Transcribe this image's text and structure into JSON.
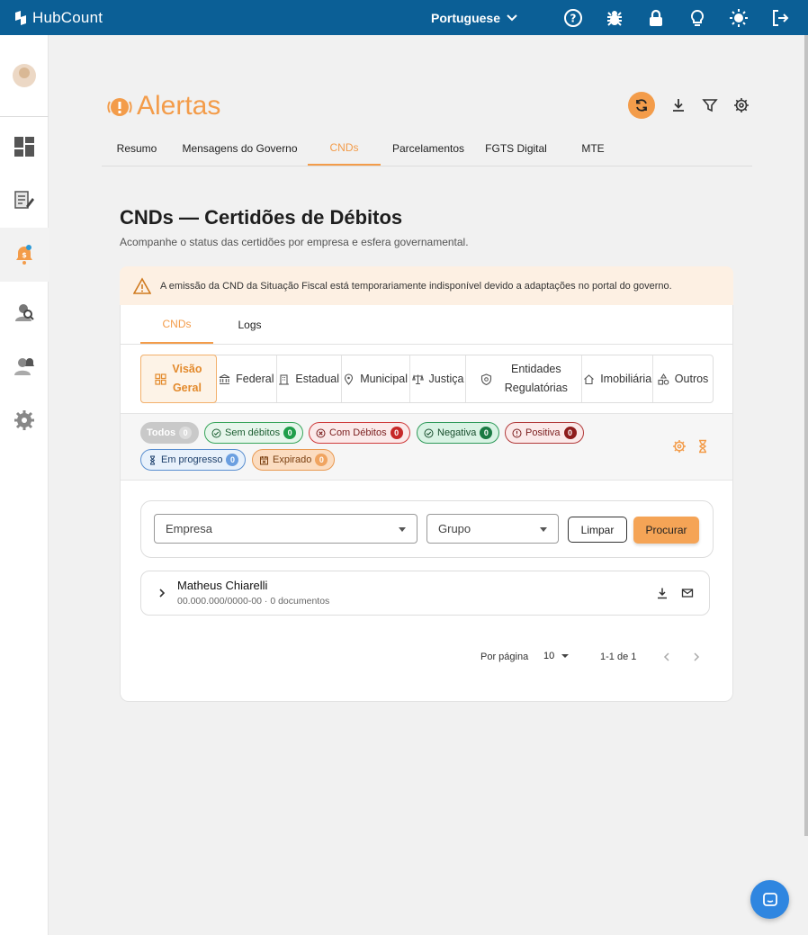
{
  "app": {
    "name": "HubCount",
    "language": "Portuguese"
  },
  "colors": {
    "topbar": "#0b5f96",
    "accent": "#f39c4a",
    "chat": "#2f86e0"
  },
  "topbar_icons": [
    "help-icon",
    "bug-icon",
    "lock-icon",
    "lightbulb-icon",
    "sun-icon",
    "logout-icon"
  ],
  "sidebar": {
    "items": [
      {
        "name": "dashboard-icon"
      },
      {
        "name": "document-edit-icon"
      },
      {
        "name": "alert-bell-icon",
        "active": true
      },
      {
        "name": "user-search-icon"
      },
      {
        "name": "user-bell-icon"
      },
      {
        "name": "settings-icon"
      }
    ]
  },
  "section": {
    "logo_text": "Alertas"
  },
  "main_tabs": [
    "Resumo",
    "Mensagens do Governo",
    "CNDs",
    "Parcelamentos",
    "FGTS Digital",
    "MTE"
  ],
  "page": {
    "title": "CNDs — Certidões de Débitos",
    "subtitle": "Acompanhe o status das certidões por empresa e esfera governamental."
  },
  "warning": "A emissão da CND da Situação Fiscal está temporariamente indisponível devido a adaptações no portal do governo.",
  "sub_tabs": [
    "CNDs",
    "Logs"
  ],
  "spheres": [
    {
      "line1": "Visão",
      "line2": "Geral"
    },
    {
      "label": "Federal"
    },
    {
      "label": "Estadual"
    },
    {
      "label": "Municipal"
    },
    {
      "label": "Justiça"
    },
    {
      "line1": "Entidades",
      "line2": "Regulatórias"
    },
    {
      "label": "Imobiliária"
    },
    {
      "label": "Outros"
    }
  ],
  "status_chips": [
    {
      "label": "Todos",
      "count": "0"
    },
    {
      "label": "Sem débitos",
      "count": "0"
    },
    {
      "label": "Com Débitos",
      "count": "0"
    },
    {
      "label": "Negativa",
      "count": "0"
    },
    {
      "label": "Positiva",
      "count": "0"
    },
    {
      "label": "Em progresso",
      "count": "0"
    },
    {
      "label": "Expirado",
      "count": "0"
    }
  ],
  "search": {
    "empresa_placeholder": "Empresa",
    "grupo_placeholder": "Grupo",
    "clear_label": "Limpar",
    "search_label": "Procurar"
  },
  "companies": [
    {
      "name": "Matheus Chiarelli",
      "meta": "00.000.000/0000-00 · 0 documentos"
    }
  ],
  "pagination": {
    "per_page_label": "Por página",
    "per_page": "10",
    "range": "1-1 de 1"
  }
}
